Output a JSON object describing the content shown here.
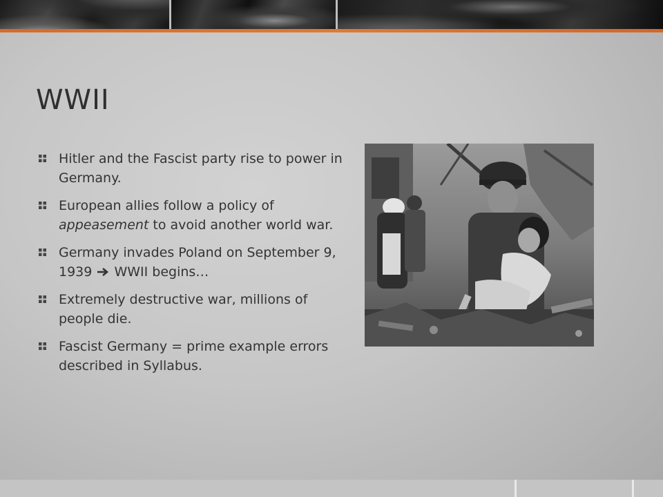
{
  "slide": {
    "title": "WWII",
    "bullets": [
      {
        "text": "Hitler and the Fascist party rise to power in Germany."
      },
      {
        "before": "European allies follow a policy of ",
        "emphasis": "appeasement",
        "after": " to avoid another world war."
      },
      {
        "before": "Germany invades Poland on September 9, 1939 ",
        "after": " WWII begins…",
        "icon": "right-arrow-icon"
      },
      {
        "text": "Extremely destructive war, millions of people die."
      },
      {
        "text": "Fascist Germany = prime example errors described in Syllabus."
      }
    ],
    "bullet_icon": "square-bullet-icon",
    "image": {
      "semantic": "wwii-soldier-carrying-child-photo"
    }
  },
  "theme": {
    "accent": "#e07a34",
    "text": "#333333",
    "background": "#c6c6c6"
  }
}
